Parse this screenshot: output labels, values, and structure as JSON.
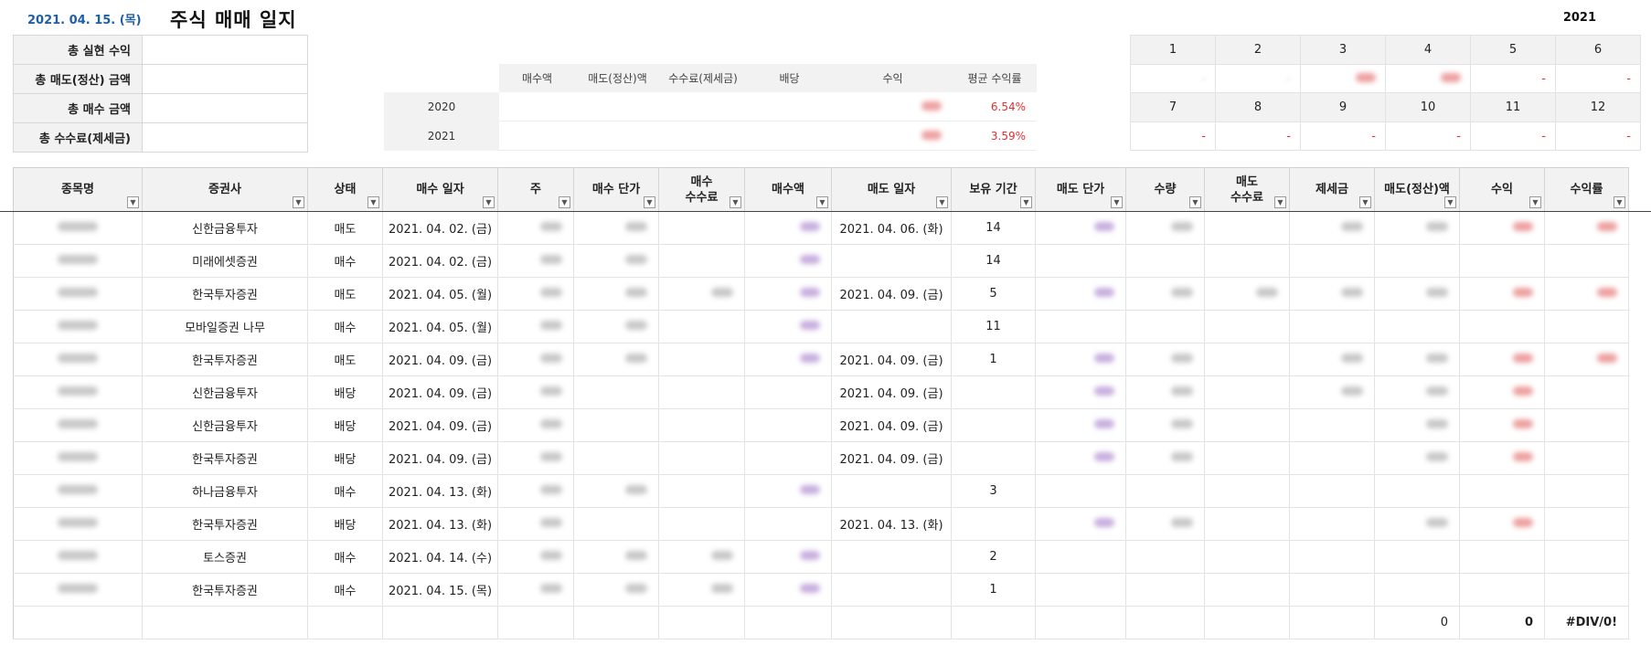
{
  "header": {
    "date": "2021. 04. 15. (목)",
    "title": "주식 매매 일지",
    "year": "2021"
  },
  "summary": [
    {
      "label": "총 실현 수익"
    },
    {
      "label": "총 매도(정산) 금액"
    },
    {
      "label": "총 매수 금액"
    },
    {
      "label": "총 수수료(제세금)"
    }
  ],
  "stats": {
    "headers": [
      "매수액",
      "매도(정산)액",
      "수수료(제세금)",
      "배당",
      "수익",
      "평균 수익률"
    ],
    "rows": [
      {
        "year": "2020",
        "avg_return": "6.54%"
      },
      {
        "year": "2021",
        "avg_return": "3.59%"
      }
    ]
  },
  "months": {
    "row1": [
      "1",
      "2",
      "3",
      "4",
      "5",
      "6"
    ],
    "row1_values": [
      "-",
      "-",
      "",
      "",
      "-",
      "-"
    ],
    "row2": [
      "7",
      "8",
      "9",
      "10",
      "11",
      "12"
    ],
    "row2_values": [
      "-",
      "-",
      "-",
      "-",
      "-",
      "-"
    ]
  },
  "journal": {
    "columns": [
      "종목명",
      "증권사",
      "상태",
      "매수 일자",
      "주",
      "매수 단가",
      "매수\n수수료",
      "매수액",
      "매도 일자",
      "보유 기간",
      "매도 단가",
      "수량",
      "매도\n수수료",
      "제세금",
      "매도(정산)액",
      "수익",
      "수익률"
    ],
    "rows": [
      {
        "broker": "신한금융투자",
        "status": "매도",
        "buy_date": "2021. 04. 02. (금)",
        "sell_date": "2021. 04. 06. (화)",
        "hold": "14"
      },
      {
        "broker": "미래에셋증권",
        "status": "매수",
        "buy_date": "2021. 04. 02. (금)",
        "sell_date": "",
        "hold": "14"
      },
      {
        "broker": "한국투자증권",
        "status": "매도",
        "buy_date": "2021. 04. 05. (월)",
        "sell_date": "2021. 04. 09. (금)",
        "hold": "5"
      },
      {
        "broker": "모바일증권 나무",
        "status": "매수",
        "buy_date": "2021. 04. 05. (월)",
        "sell_date": "",
        "hold": "11"
      },
      {
        "broker": "한국투자증권",
        "status": "매도",
        "buy_date": "2021. 04. 09. (금)",
        "sell_date": "2021. 04. 09. (금)",
        "hold": "1"
      },
      {
        "broker": "신한금융투자",
        "status": "배당",
        "buy_date": "2021. 04. 09. (금)",
        "sell_date": "2021. 04. 09. (금)",
        "hold": ""
      },
      {
        "broker": "신한금융투자",
        "status": "배당",
        "buy_date": "2021. 04. 09. (금)",
        "sell_date": "2021. 04. 09. (금)",
        "hold": ""
      },
      {
        "broker": "한국투자증권",
        "status": "배당",
        "buy_date": "2021. 04. 09. (금)",
        "sell_date": "2021. 04. 09. (금)",
        "hold": ""
      },
      {
        "broker": "하나금융투자",
        "status": "매수",
        "buy_date": "2021. 04. 13. (화)",
        "sell_date": "",
        "hold": "3"
      },
      {
        "broker": "한국투자증권",
        "status": "배당",
        "buy_date": "2021. 04. 13. (화)",
        "sell_date": "2021. 04. 13. (화)",
        "hold": ""
      },
      {
        "broker": "토스증권",
        "status": "매수",
        "buy_date": "2021. 04. 14. (수)",
        "sell_date": "",
        "hold": "2"
      },
      {
        "broker": "한국투자증권",
        "status": "매수",
        "buy_date": "2021. 04. 15. (목)",
        "sell_date": "",
        "hold": "1"
      }
    ],
    "totals": {
      "settle": "0",
      "profit": "0",
      "rate": "#DIV/0!"
    }
  },
  "colors": {
    "sell": "#2f7ed8",
    "buy": "#e53935",
    "dividend": "#8e5ad6",
    "negative": "#e03030"
  }
}
